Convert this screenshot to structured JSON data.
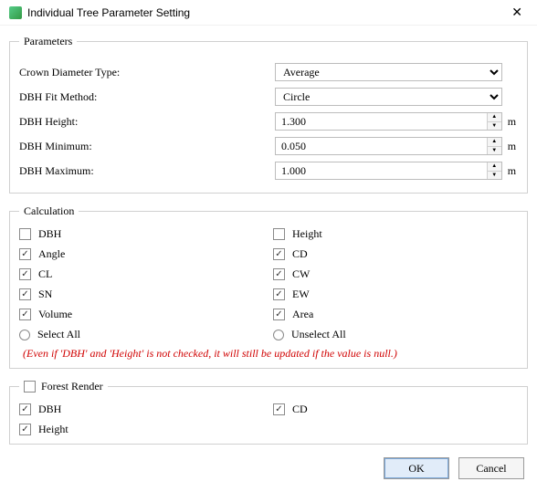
{
  "window": {
    "title": "Individual Tree Parameter Setting"
  },
  "parameters": {
    "legend": "Parameters",
    "crown_diameter_type": {
      "label": "Crown Diameter Type:",
      "value": "Average"
    },
    "dbh_fit_method": {
      "label": "DBH Fit Method:",
      "value": "Circle"
    },
    "dbh_height": {
      "label": "DBH Height:",
      "value": "1.300",
      "unit": "m"
    },
    "dbh_minimum": {
      "label": "DBH Minimum:",
      "value": "0.050",
      "unit": "m"
    },
    "dbh_maximum": {
      "label": "DBH Maximum:",
      "value": "1.000",
      "unit": "m"
    }
  },
  "calculation": {
    "legend": "Calculation",
    "items": [
      {
        "label": "DBH",
        "checked": false
      },
      {
        "label": "Height",
        "checked": false
      },
      {
        "label": "Angle",
        "checked": true
      },
      {
        "label": "CD",
        "checked": true
      },
      {
        "label": "CL",
        "checked": true
      },
      {
        "label": "CW",
        "checked": true
      },
      {
        "label": "SN",
        "checked": true
      },
      {
        "label": "EW",
        "checked": true
      },
      {
        "label": "Volume",
        "checked": true
      },
      {
        "label": "Area",
        "checked": true
      }
    ],
    "select_all": "Select All",
    "unselect_all": "Unselect All",
    "note": "(Even if 'DBH' and 'Height' is not checked, it will still be updated if the value is null.)"
  },
  "forest_render": {
    "legend": "Forest Render",
    "legend_checked": false,
    "items": [
      {
        "label": "DBH",
        "checked": true
      },
      {
        "label": "CD",
        "checked": true
      },
      {
        "label": "Height",
        "checked": true
      }
    ]
  },
  "buttons": {
    "ok": "OK",
    "cancel": "Cancel"
  }
}
